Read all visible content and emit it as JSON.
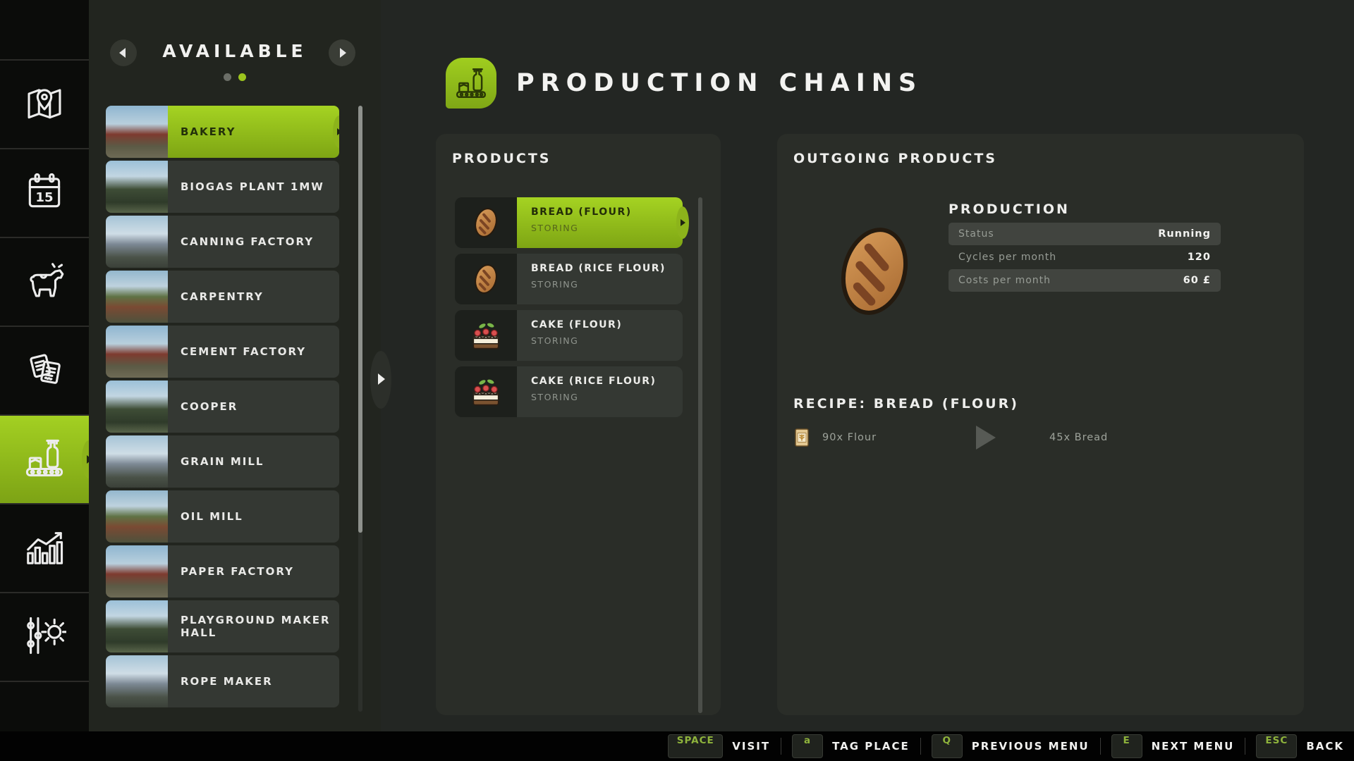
{
  "accent_color": "#8cbc1e",
  "sidebar": {
    "calendar_day": "15",
    "items": [
      {
        "name": "map",
        "icon": "map-icon",
        "active": false
      },
      {
        "name": "calendar",
        "icon": "calendar-icon",
        "active": false
      },
      {
        "name": "animals",
        "icon": "cow-icon",
        "active": false
      },
      {
        "name": "contracts",
        "icon": "documents-icon",
        "active": false
      },
      {
        "name": "production",
        "icon": "production-icon",
        "active": true
      },
      {
        "name": "statistics",
        "icon": "chart-icon",
        "active": false
      },
      {
        "name": "finances",
        "icon": "sliders-gear-icon",
        "active": false
      }
    ]
  },
  "available": {
    "title": "AVAILABLE",
    "pagination": [
      {
        "active": false
      },
      {
        "active": true
      }
    ],
    "items": [
      {
        "label": "BAKERY",
        "selected": true
      },
      {
        "label": "BIOGAS PLANT 1MW",
        "selected": false
      },
      {
        "label": "CANNING FACTORY",
        "selected": false
      },
      {
        "label": "CARPENTRY",
        "selected": false
      },
      {
        "label": "CEMENT FACTORY",
        "selected": false
      },
      {
        "label": "COOPER",
        "selected": false
      },
      {
        "label": "GRAIN MILL",
        "selected": false
      },
      {
        "label": "OIL MILL",
        "selected": false
      },
      {
        "label": "PAPER FACTORY",
        "selected": false
      },
      {
        "label": "PLAYGROUND MAKER HALL",
        "selected": false
      },
      {
        "label": "ROPE MAKER",
        "selected": false
      }
    ]
  },
  "header": {
    "title": "PRODUCTION CHAINS"
  },
  "products": {
    "title": "PRODUCTS",
    "items": [
      {
        "name": "BREAD (FLOUR)",
        "status": "STORING",
        "icon": "bread",
        "selected": true
      },
      {
        "name": "BREAD (RICE FLOUR)",
        "status": "STORING",
        "icon": "bread",
        "selected": false
      },
      {
        "name": "CAKE (FLOUR)",
        "status": "STORING",
        "icon": "cake",
        "selected": false
      },
      {
        "name": "CAKE (RICE FLOUR)",
        "status": "STORING",
        "icon": "cake",
        "selected": false
      }
    ]
  },
  "outgoing": {
    "title": "OUTGOING PRODUCTS",
    "production": {
      "title": "PRODUCTION",
      "rows": [
        {
          "label": "Status",
          "value": "Running"
        },
        {
          "label": "Cycles per month",
          "value": "120"
        },
        {
          "label": "Costs per month",
          "value": "60 £"
        }
      ]
    },
    "recipe": {
      "title": "RECIPE: BREAD (FLOUR)",
      "input_label": "90x Flour",
      "output_label": "45x Bread"
    }
  },
  "hotkeys": [
    {
      "key": "SPACE",
      "action": "VISIT"
    },
    {
      "key": "a",
      "action": "TAG PLACE"
    },
    {
      "key": "Q",
      "action": "PREVIOUS MENU"
    },
    {
      "key": "E",
      "action": "NEXT MENU"
    },
    {
      "key": "ESC",
      "action": "BACK"
    }
  ]
}
